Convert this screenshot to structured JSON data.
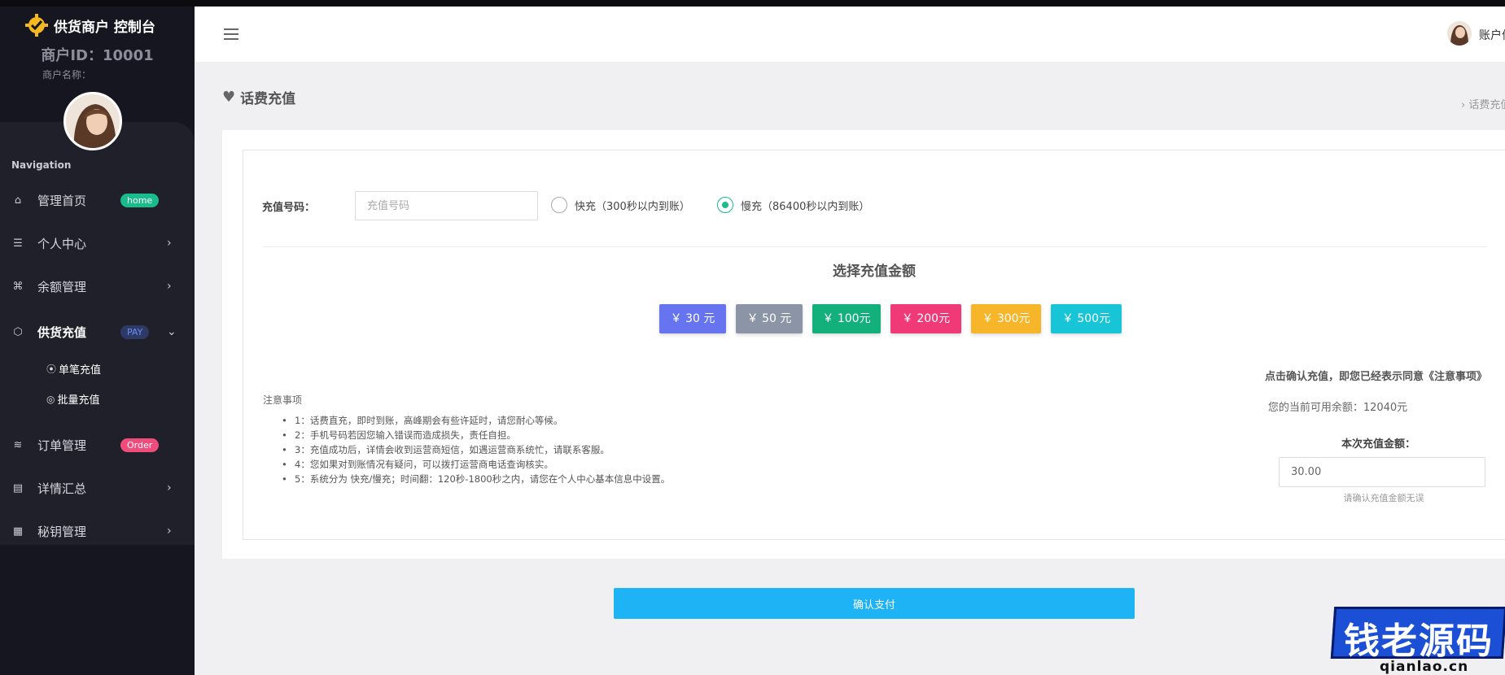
{
  "brand": {
    "title": "供货商户 控制台",
    "merchant_id": "商户ID：10001",
    "merchant_name": "商户名称："
  },
  "sidebar": {
    "nav_label": "Navigation",
    "items": [
      {
        "label": "管理首页",
        "icon": "home-icon",
        "badge": "home"
      },
      {
        "label": "个人中心",
        "icon": "list-icon"
      },
      {
        "label": "余额管理",
        "icon": "command-icon"
      },
      {
        "label": "供货充值",
        "icon": "box-icon",
        "badge": "PAY"
      },
      {
        "label": "订单管理",
        "icon": "layers-icon",
        "badge": "Order"
      },
      {
        "label": "详情汇总",
        "icon": "document-icon"
      },
      {
        "label": "秘钥管理",
        "icon": "map-icon"
      }
    ],
    "sub_items": [
      {
        "label": "单笔充值",
        "icon": "broadcast-icon"
      },
      {
        "label": "批量充值",
        "icon": "swirl-icon"
      }
    ]
  },
  "header": {
    "account": "账户信息"
  },
  "page": {
    "title": "话费充值",
    "breadcrumb": "› 话费充值"
  },
  "form": {
    "phone_label": "充值号码：",
    "phone_placeholder": "充值号码",
    "options": [
      {
        "label": "快充（300秒以内到账）",
        "selected": false
      },
      {
        "label": "慢充（86400秒以内到账）",
        "selected": true
      }
    ],
    "amount_title": "选择充值金额",
    "amounts": [
      {
        "label": "￥ 30 元",
        "color": "#6674f0"
      },
      {
        "label": "￥ 50 元",
        "color": "#8b95a5"
      },
      {
        "label": "￥ 100元",
        "color": "#13b07c"
      },
      {
        "label": "￥ 200元",
        "color": "#f03a77"
      },
      {
        "label": "￥ 300元",
        "color": "#f7b52a"
      },
      {
        "label": "￥ 500元",
        "color": "#17c5d6"
      }
    ],
    "notes_title": "注意事项",
    "notes": [
      "1：话费直充，即时到账，高峰期会有些许延时，请您耐心等候。",
      "2：手机号码若因您输入错误而造成损失，责任自担。",
      "3：充值成功后，详情会收到运营商短信，如遇运营商系统忙，请联系客服。",
      "4：您如果对到账情况有疑问，可以拨打运营商电话查询核实。",
      "5：系统分为 快充/慢充；时间翻：120秒-1800秒之内，请您在个人中心基本信息中设置。"
    ],
    "agree_text": "点击确认充值，即您已经表示同意《注意事项》",
    "balance_text": "您的当前可用余额：12040元",
    "this_amount_label": "本次充值金额：",
    "this_amount_value": "30.00",
    "amount_hint": "请确认充值金额无误",
    "pay_button": "确认支付"
  },
  "watermark": {
    "text": "钱老源码",
    "url": "qianlao.cn"
  }
}
